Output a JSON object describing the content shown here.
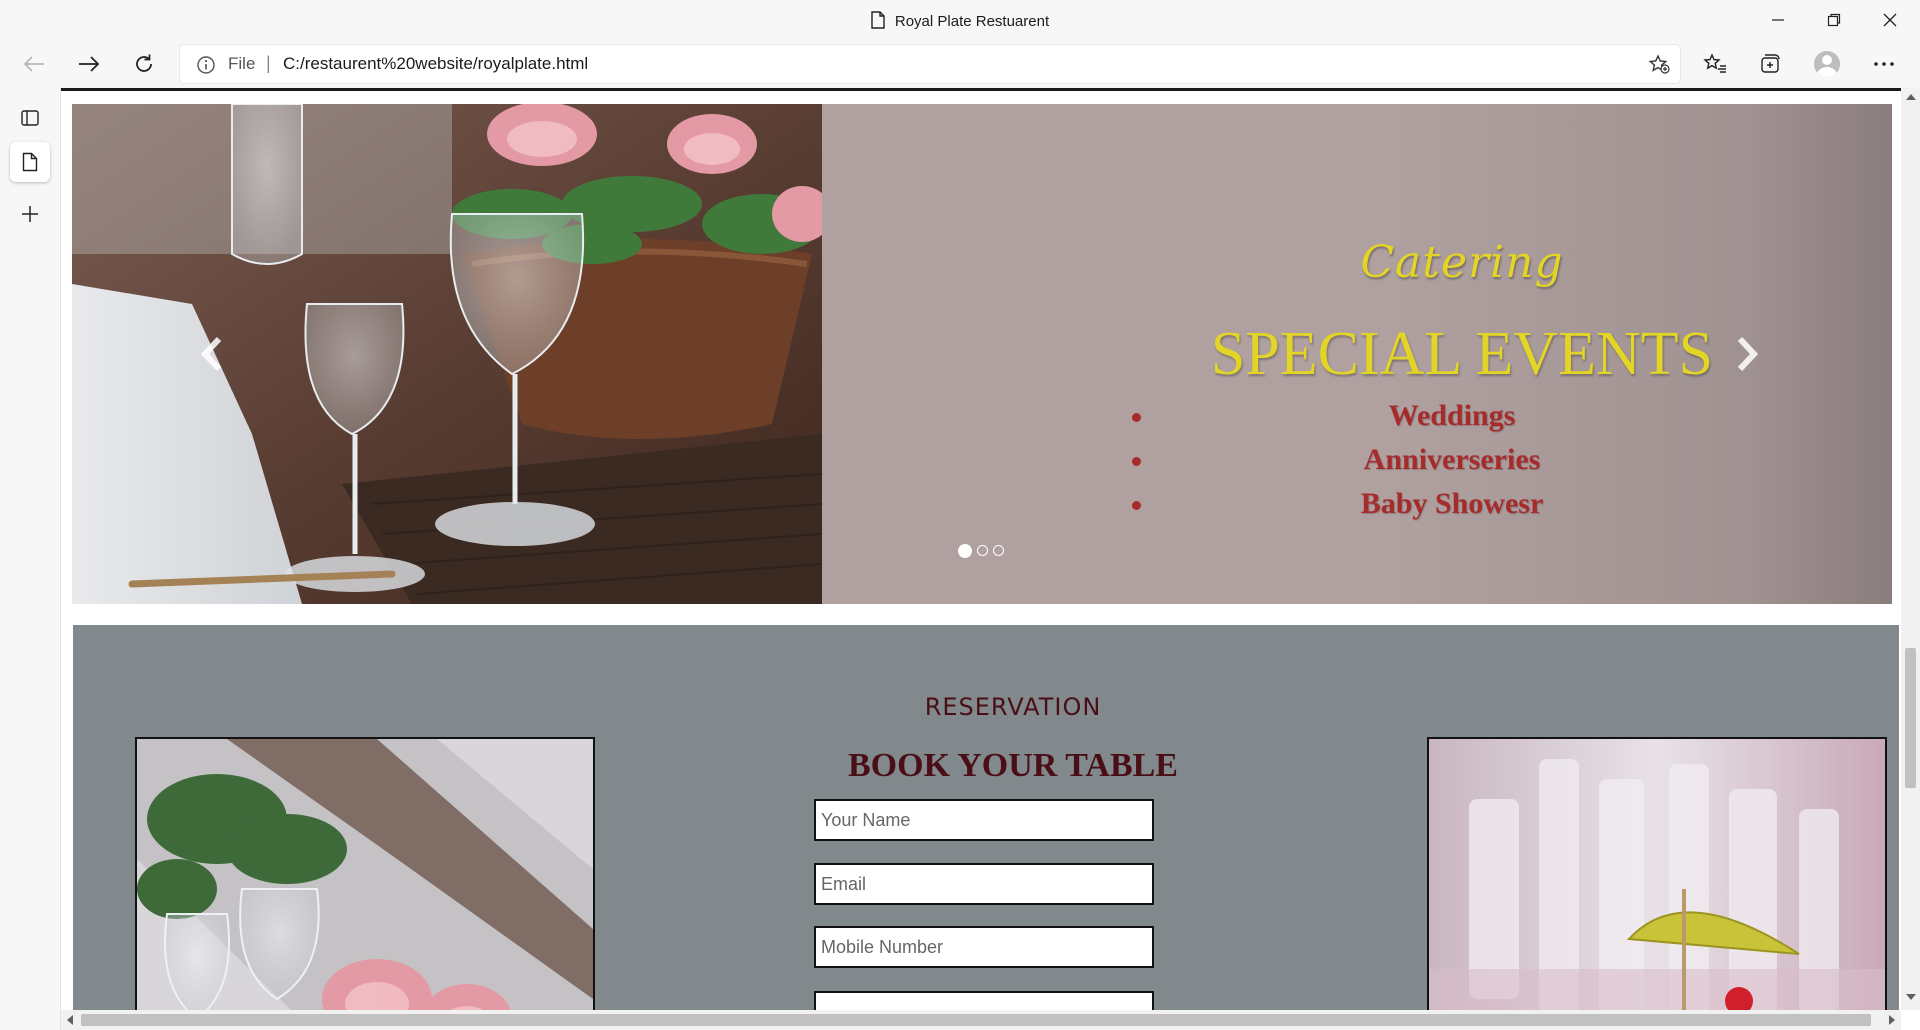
{
  "window": {
    "title": "Royal Plate Restuarent"
  },
  "address_bar": {
    "security_label": "File",
    "url": "C:/restaurent%20website/royalplate.html"
  },
  "carousel": {
    "caption_script": "Catering",
    "caption_title": "SPECIAL EVENTS",
    "events": [
      "Weddings",
      "Anniverseries",
      "Baby Showesr"
    ],
    "indicator_count": 3,
    "active_indicator": 0
  },
  "reservation": {
    "kicker": "RESERVATION",
    "title": "BOOK YOUR TABLE",
    "fields": {
      "name_placeholder": "Your Name",
      "email_placeholder": "Email",
      "mobile_placeholder": "Mobile Number"
    }
  },
  "colors": {
    "slide_bg": "#b0a1a0",
    "caption_yellow": "#e3d526",
    "events_red": "#a62b2b",
    "reservation_bg": "#81898c",
    "reservation_text": "#4a0e17"
  }
}
